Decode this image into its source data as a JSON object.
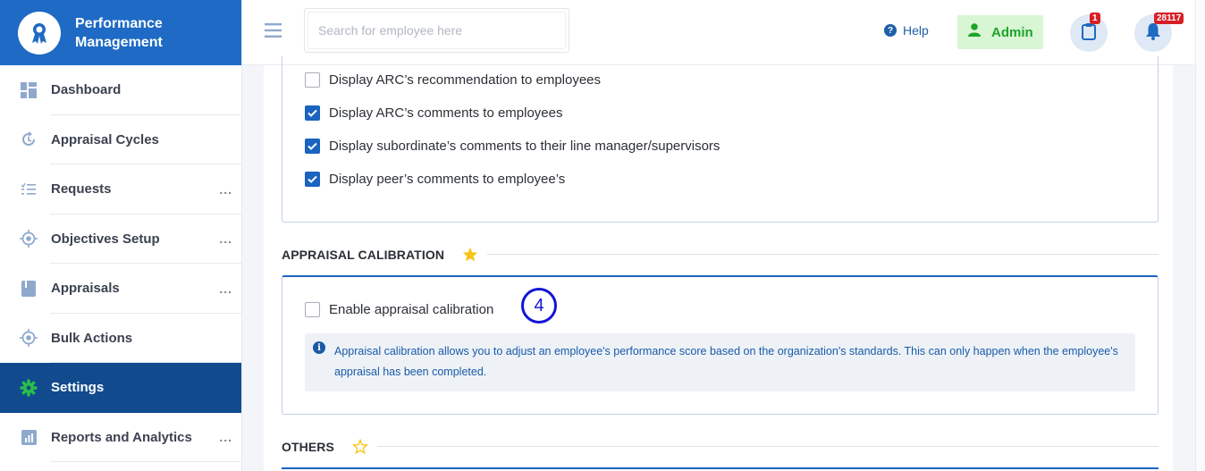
{
  "brand": {
    "title": "Performance Management"
  },
  "sidebar": {
    "items": [
      {
        "label": "Dashboard",
        "icon": "dashboard-icon",
        "dots": ""
      },
      {
        "label": "Appraisal Cycles",
        "icon": "cycle-icon",
        "dots": ""
      },
      {
        "label": "Requests",
        "icon": "list-icon",
        "dots": "..."
      },
      {
        "label": "Objectives Setup",
        "icon": "target-icon",
        "dots": "..."
      },
      {
        "label": "Appraisals",
        "icon": "book-icon",
        "dots": "..."
      },
      {
        "label": "Bulk Actions",
        "icon": "target-icon",
        "dots": ""
      },
      {
        "label": "Settings",
        "icon": "gear-icon",
        "dots": ""
      },
      {
        "label": "Reports and Analytics",
        "icon": "chart-icon",
        "dots": "..."
      }
    ]
  },
  "header": {
    "search_placeholder": "Search for employee here",
    "help_label": "Help",
    "admin_label": "Admin",
    "clipboard_badge": "1",
    "bell_badge": "28117"
  },
  "display_options": [
    {
      "label": "Display ARC’s recommendation to employees",
      "checked": false
    },
    {
      "label": "Display ARC’s comments to employees",
      "checked": true
    },
    {
      "label": "Display subordinate’s comments to their line manager/supervisors",
      "checked": true
    },
    {
      "label": "Display peer’s comments to employee’s",
      "checked": true
    }
  ],
  "calibration": {
    "title": "APPRAISAL CALIBRATION",
    "enable_label": "Enable appraisal calibration",
    "enabled": false,
    "annotation": "4",
    "info_text": "Appraisal calibration allows you to adjust an employee's performance score based on the organization's standards. This can only happen when the employee's appraisal has been completed."
  },
  "others": {
    "title": "OTHERS"
  },
  "colors": {
    "primary": "#1e6ac4",
    "active_nav": "#114b8e",
    "admin_green": "#1fa32a",
    "badge_red": "#d71f26",
    "star_yellow": "#f5c518"
  }
}
